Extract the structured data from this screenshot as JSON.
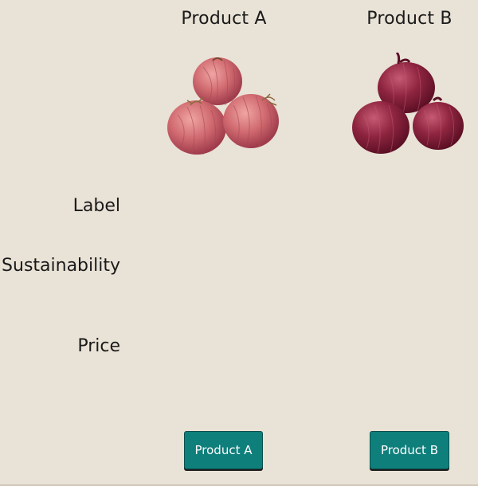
{
  "columns": {
    "a": {
      "title": "Product A",
      "image": "red-onion-pile-icon"
    },
    "b": {
      "title": "Product B",
      "image": "red-onion-pile-icon"
    }
  },
  "rows": {
    "label": "Label",
    "sustainability": "Sustainability",
    "price": "Price"
  },
  "buttons": {
    "a": "Product A",
    "b": "Product B"
  },
  "colors": {
    "background": "#e9e2d6",
    "button": "#0f7f7b",
    "onion_a": "#c9606e",
    "onion_b": "#9c2843"
  }
}
